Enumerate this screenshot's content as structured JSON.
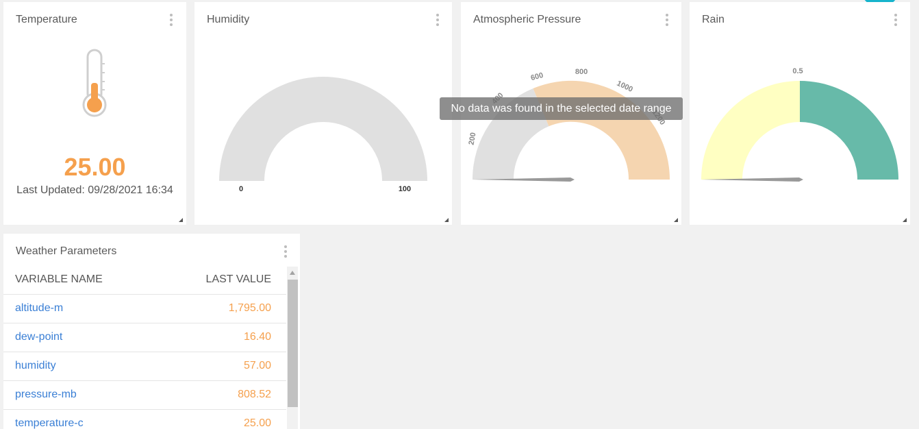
{
  "widgets": {
    "temperature": {
      "title": "Temperature",
      "value": "25.00",
      "last_updated": "Last Updated: 09/28/2021 16:34",
      "icon": "thermometer-icon",
      "value_color": "#f5a04d"
    },
    "humidity": {
      "title": "Humidity",
      "min_label": "0",
      "max_label": "100",
      "gauge_color": "#e0e0e0"
    },
    "pressure": {
      "title": "Atmospheric Pressure",
      "tick_labels": [
        "200",
        "400",
        "600",
        "800",
        "1000",
        "1200"
      ],
      "no_data_message": "No data was found in the selected date range",
      "colors": {
        "low": "#e0e0e0",
        "high": "#f5d5b0"
      }
    },
    "rain": {
      "title": "Rain",
      "tick_label": "0.5",
      "colors": {
        "left": "#ffffc2",
        "right": "#67baa9"
      }
    },
    "weather_params": {
      "title": "Weather Parameters",
      "columns": {
        "name": "VARIABLE NAME",
        "value": "LAST VALUE"
      },
      "rows": [
        {
          "name": "altitude-m",
          "value": "1,795.00"
        },
        {
          "name": "dew-point",
          "value": "16.40"
        },
        {
          "name": "humidity",
          "value": "57.00"
        },
        {
          "name": "pressure-mb",
          "value": "808.52"
        },
        {
          "name": "temperature-c",
          "value": "25.00"
        }
      ]
    }
  },
  "colors": {
    "background": "#f1f1f1",
    "accent_orange": "#f5a04d",
    "link_blue": "#3a7fd5",
    "fab_teal": "#17b4cc"
  }
}
